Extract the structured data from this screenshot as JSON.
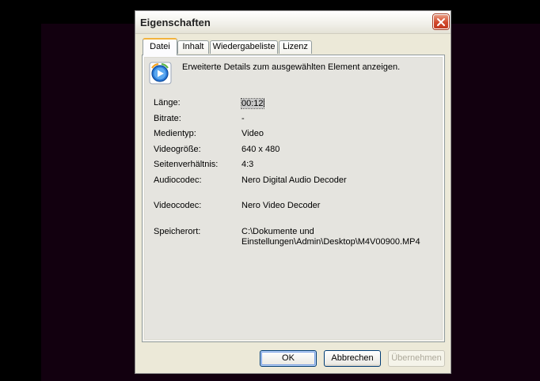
{
  "dialog": {
    "title": "Eigenschaften"
  },
  "tabs": [
    {
      "label": "Datei",
      "active": true
    },
    {
      "label": "Inhalt",
      "active": false
    },
    {
      "label": "Wiedergabeliste",
      "active": false
    },
    {
      "label": "Lizenz",
      "active": false
    }
  ],
  "file_tab": {
    "intro": "Erweiterte Details zum ausgewählten Element anzeigen.",
    "properties": [
      {
        "label": "Länge:",
        "value": "00:12"
      },
      {
        "label": "Bitrate:",
        "value": "-"
      },
      {
        "label": "Medientyp:",
        "value": "Video"
      },
      {
        "label": "Videogröße:",
        "value": "640 x 480"
      },
      {
        "label": "Seitenverhältnis:",
        "value": "4:3"
      },
      {
        "label": "Audiocodec:",
        "value": "Nero Digital Audio Decoder"
      },
      {
        "label": "Videocodec:",
        "value": "Nero Video Decoder"
      },
      {
        "label": "Speicherort:",
        "value": "C:\\Dokumente und\nEinstellungen\\Admin\\Desktop\\M4V00900.MP4"
      }
    ]
  },
  "buttons": {
    "ok": "OK",
    "cancel": "Abbrechen",
    "apply": "Übernehmen"
  },
  "icons": {
    "close": "close-icon",
    "media": "media-player-icon"
  },
  "colors": {
    "dialog_bg": "#ece9d8",
    "panel_bg": "#e5e4df",
    "close_red": "#d1482b",
    "active_tab_accent": "#f3b33d",
    "button_border": "#003c74",
    "disabled_text": "#aca899"
  }
}
